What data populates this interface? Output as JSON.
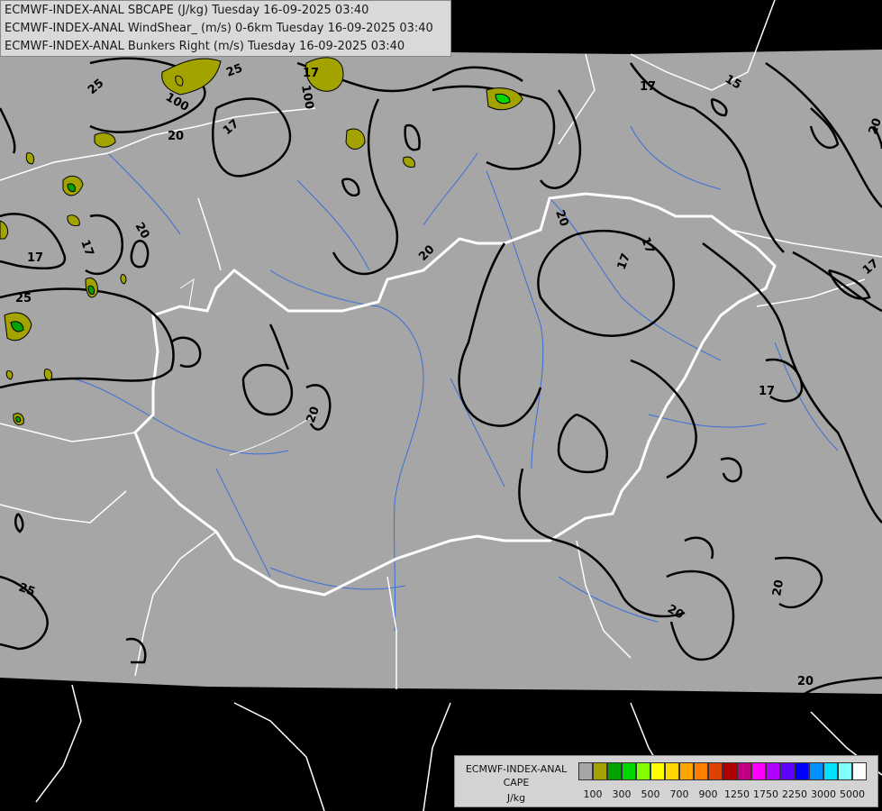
{
  "header": {
    "line1": "ECMWF-INDEX-ANAL SBCAPE (J/kg) Tuesday 16-09-2025 03:40",
    "line2": "ECMWF-INDEX-ANAL WindShear_ (m/s) 0-6km Tuesday 16-09-2025 03:40",
    "line3": "ECMWF-INDEX-ANAL Bunkers Right (m/s) Tuesday 16-09-2025 03:40"
  },
  "contour_labels": [
    "25",
    "17",
    "25",
    "100",
    "100",
    "17",
    "20",
    "17",
    "17",
    "15",
    "20",
    "17",
    "20",
    "17",
    "17",
    "25",
    "20",
    "17",
    "17",
    "20",
    "20",
    "20",
    "20",
    "25",
    "20"
  ],
  "legend": {
    "title_line1": "ECMWF-INDEX-ANAL",
    "title_line2": "CAPE",
    "title_line3": "J/kg",
    "colors": [
      "#a6a6a6",
      "#a3a300",
      "#00a300",
      "#00d600",
      "#7fff00",
      "#ffff00",
      "#ffd700",
      "#ffa500",
      "#ff7f00",
      "#e04000",
      "#b00000",
      "#c00080",
      "#ff00ff",
      "#b000ff",
      "#6000ff",
      "#0000ff",
      "#0090ff",
      "#00e0ff",
      "#80ffff",
      "#ffffff"
    ],
    "tick_labels": [
      "100",
      "300",
      "500",
      "700",
      "900",
      "1250",
      "1750",
      "2250",
      "3000",
      "5000"
    ]
  },
  "colors": {
    "ocean": "#000000",
    "land": "#a6a6a6",
    "borders": "#ffffff",
    "contours": "#000000",
    "rivers": "#3a6fd8",
    "cape_low": "#a3a300"
  }
}
